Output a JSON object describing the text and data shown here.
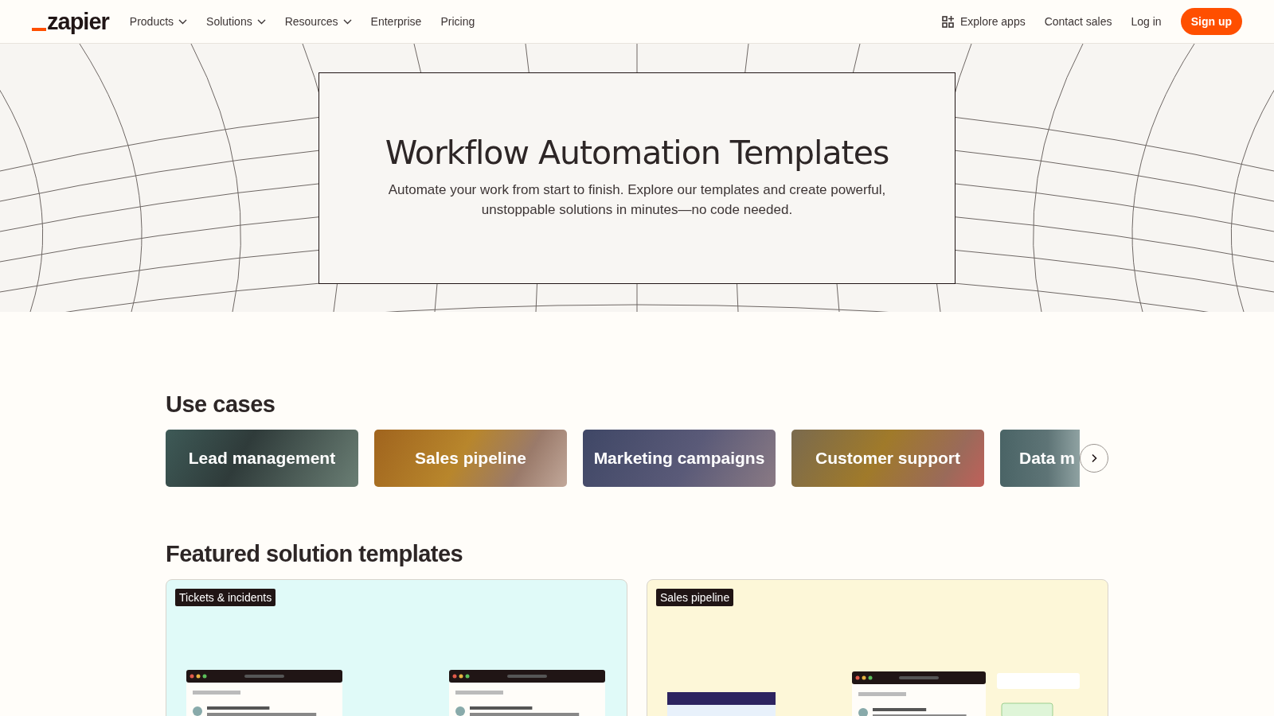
{
  "nav": {
    "logo": "zapier",
    "menu": [
      {
        "label": "Products",
        "dropdown": true
      },
      {
        "label": "Solutions",
        "dropdown": true
      },
      {
        "label": "Resources",
        "dropdown": true
      },
      {
        "label": "Enterprise",
        "dropdown": false
      },
      {
        "label": "Pricing",
        "dropdown": false
      }
    ],
    "right": {
      "explore": "Explore apps",
      "contact": "Contact sales",
      "login": "Log in",
      "signup": "Sign up"
    }
  },
  "hero": {
    "title": "Workflow Automation Templates",
    "subtitle": "Automate your work from start to finish. Explore our templates and create powerful, unstoppable solutions in minutes—no code needed."
  },
  "use_cases": {
    "heading": "Use cases",
    "items": [
      {
        "label": "Lead management"
      },
      {
        "label": "Sales pipeline"
      },
      {
        "label": "Marketing campaigns"
      },
      {
        "label": "Customer support"
      },
      {
        "label": "Data m"
      }
    ]
  },
  "featured": {
    "heading": "Featured solution templates",
    "cards": [
      {
        "tag": "Tickets & incidents",
        "color": "#e0faf8"
      },
      {
        "tag": "Sales pipeline",
        "color": "#fdf7d8"
      }
    ]
  }
}
